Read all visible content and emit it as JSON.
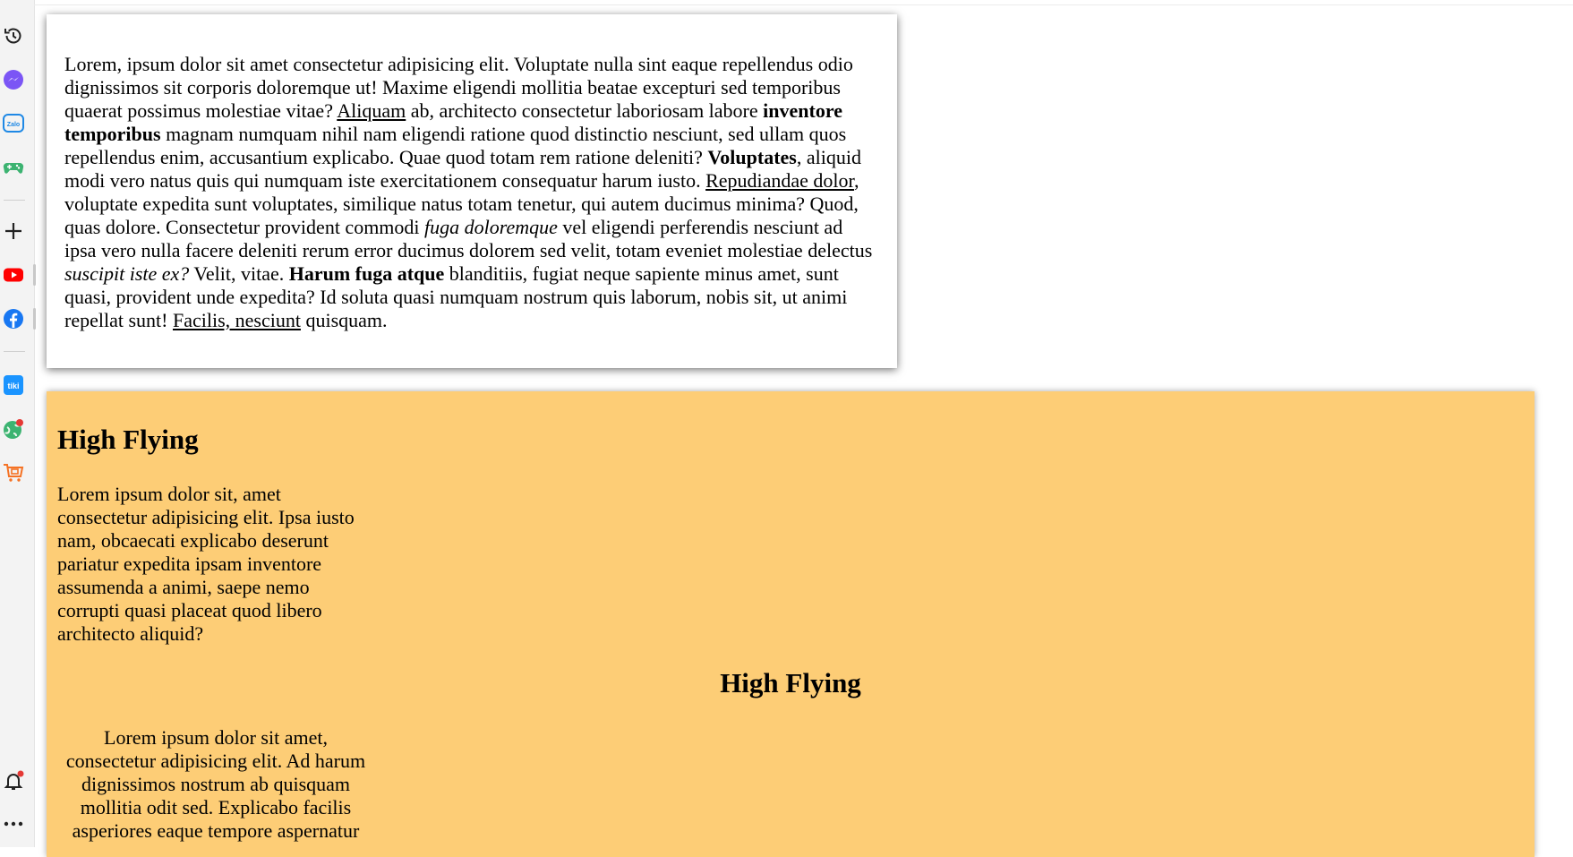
{
  "sidebar": {
    "icons": [
      "history-icon",
      "messenger-icon",
      "zalo-icon",
      "gamepad-icon",
      "add-icon",
      "youtube-icon",
      "facebook-icon",
      "tiki-icon",
      "game-globe-icon",
      "shopping-cart-icon",
      "bell-icon",
      "more-icon"
    ],
    "zalo_label": "Zalo",
    "tiki_label": "tiki",
    "colors": {
      "messenger": "#7b55f5",
      "zalo": "#1e88e5",
      "gamepad": "#3cb371",
      "youtube": "#ff0000",
      "facebook": "#1877f2",
      "tiki": "#1a94ff",
      "cart": "#f57224",
      "notification_dot": "#e53935"
    }
  },
  "card": {
    "s1": "Lorem, ipsum dolor sit amet consectetur adipisicing elit. Voluptate nulla sint eaque repellendus odio dignissimos sit corporis doloremque ut! Maxime eligendi mollitia beatae excepturi sed temporibus quaerat possimus molestiae vitae? ",
    "u1": "Aliquam",
    "s2": " ab, architecto consectetur laboriosam labore ",
    "b1": "inventore temporibus",
    "s3": " magnam numquam nihil nam eligendi ratione quod distinctio nesciunt, sed ullam quos repellendus enim, accusantium explicabo. Quae quod totam rem ratione deleniti? ",
    "b2": "Voluptates",
    "s4": ", aliquid modi vero natus quis qui numquam iste exercitationem consequatur harum iusto. ",
    "u2": "Repudiandae dolor",
    "s5": ", voluptate expedita sunt voluptates, similique natus totam tenetur, qui autem ducimus minima? Quod, quas dolore. Consectetur provident commodi ",
    "i1": "fuga doloremque",
    "s6": " vel eligendi perferendis nesciunt ad ipsa vero nulla facere deleniti rerum error ducimus dolorem sed velit, totam eveniet molestiae delectus ",
    "i2": "suscipit iste ex?",
    "s7": " Velit, vitae. ",
    "b3": "Harum fuga atque",
    "s8": " blanditiis, fugiat neque sapiente minus amet, sunt quasi, provident unde expedita? Id soluta quasi numquam nostrum quis laborum, nobis sit, ut animi repellat sunt! ",
    "u3": "Facilis, nesciunt",
    "s9": " quisquam."
  },
  "section": {
    "bg_color": "#fdcd76",
    "heading1": "High Flying",
    "para1": "Lorem ipsum dolor sit, amet consectetur adipisicing elit. Ipsa iusto nam, obcaecati explicabo deserunt pariatur expedita ipsam inventore assumenda a animi, saepe nemo corrupti quasi placeat quod libero architecto aliquid?",
    "heading2": "High Flying",
    "para2": "Lorem ipsum dolor sit amet, consectetur adipisicing elit. Ad harum dignissimos nostrum ab quisquam mollitia odit sed. Explicabo facilis asperiores eaque tempore aspernatur"
  }
}
